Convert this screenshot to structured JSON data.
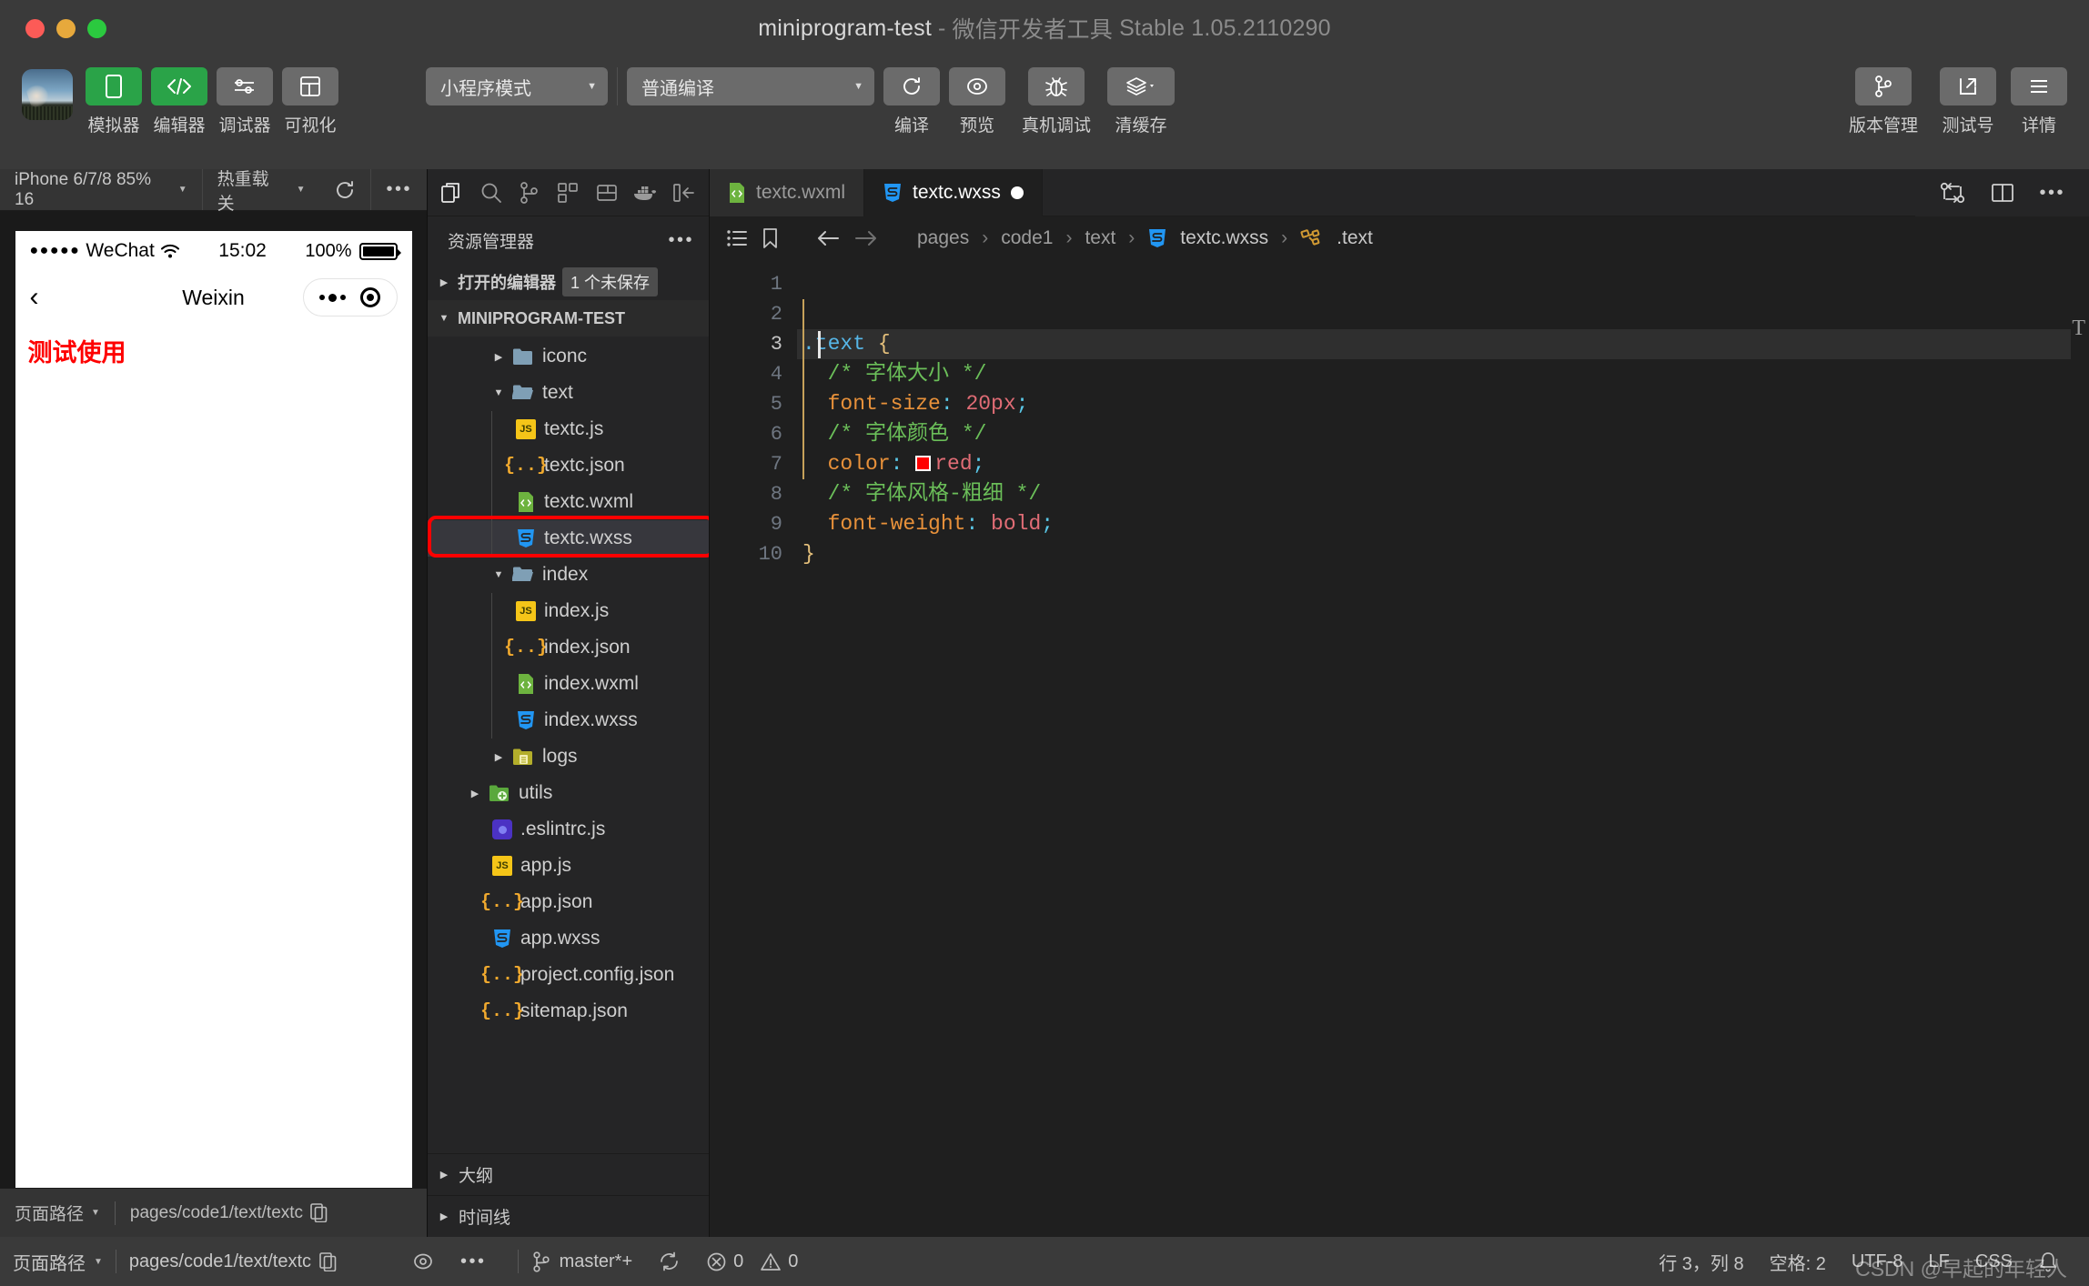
{
  "window": {
    "project": "miniprogram-test",
    "separator": "-",
    "app_name": "微信开发者工具",
    "version": "Stable 1.05.2110290"
  },
  "toolbar": {
    "left_items": [
      {
        "label": "模拟器",
        "icon": "phone-icon",
        "style": "green"
      },
      {
        "label": "编辑器",
        "icon": "code-icon",
        "style": "green"
      },
      {
        "label": "调试器",
        "icon": "sliders-icon",
        "style": "gray"
      },
      {
        "label": "可视化",
        "icon": "layout-icon",
        "style": "gray"
      }
    ],
    "mode_select": "小程序模式",
    "compile_select": "普通编译",
    "center_items": [
      {
        "label": "编译",
        "icon": "refresh-icon"
      },
      {
        "label": "预览",
        "icon": "eye-icon"
      },
      {
        "label": "真机调试",
        "icon": "bug-icon"
      },
      {
        "label": "清缓存",
        "icon": "layers-icon"
      }
    ],
    "right_items": [
      {
        "label": "版本管理",
        "icon": "git-branch-icon"
      },
      {
        "label": "测试号",
        "icon": "external-link-icon"
      },
      {
        "label": "详情",
        "icon": "menu-icon"
      }
    ]
  },
  "simulator": {
    "device": "iPhone 6/7/8 85% 16",
    "hot_reload": "热重载 关",
    "phone": {
      "carrier": "WeChat",
      "signal_dots": "●●●●●",
      "time": "15:02",
      "battery": "100%",
      "nav_title": "Weixin",
      "back_icon": "chevron-left-icon",
      "page_text": "测试使用"
    },
    "bottom": {
      "path_label": "页面路径",
      "path_value": "pages/code1/text/textc"
    }
  },
  "explorer": {
    "activity_icons": [
      "files-icon",
      "search-icon",
      "source-control-icon",
      "extensions-icon",
      "cloud-icon",
      "docker-icon",
      "collapse-icon"
    ],
    "title": "资源管理器",
    "more_icon": "ellipsis-icon",
    "open_editors_label": "打开的编辑器",
    "unsaved_badge": "1 个未保存",
    "project_label": "MINIPROGRAM-TEST",
    "tree": [
      {
        "name": "iconc",
        "kind": "folder",
        "depth": 2,
        "expanded": false,
        "color": "blue"
      },
      {
        "name": "text",
        "kind": "folder",
        "depth": 2,
        "expanded": true,
        "color": "blue"
      },
      {
        "name": "textc.js",
        "kind": "js",
        "depth": 3
      },
      {
        "name": "textc.json",
        "kind": "json",
        "depth": 3
      },
      {
        "name": "textc.wxml",
        "kind": "wxml",
        "depth": 3
      },
      {
        "name": "textc.wxss",
        "kind": "wxss",
        "depth": 3,
        "selected": true,
        "highlighted": true
      },
      {
        "name": "index",
        "kind": "folder",
        "depth": 2,
        "expanded": true,
        "color": "blue"
      },
      {
        "name": "index.js",
        "kind": "js",
        "depth": 3
      },
      {
        "name": "index.json",
        "kind": "json",
        "depth": 3
      },
      {
        "name": "index.wxml",
        "kind": "wxml",
        "depth": 3
      },
      {
        "name": "index.wxss",
        "kind": "wxss",
        "depth": 3
      },
      {
        "name": "logs",
        "kind": "folder",
        "depth": 2,
        "expanded": false,
        "color": "yellow"
      },
      {
        "name": "utils",
        "kind": "folder",
        "depth": 1,
        "expanded": false,
        "color": "green"
      },
      {
        "name": ".eslintrc.js",
        "kind": "eslint",
        "depth": 2
      },
      {
        "name": "app.js",
        "kind": "js",
        "depth": 2
      },
      {
        "name": "app.json",
        "kind": "json",
        "depth": 2
      },
      {
        "name": "app.wxss",
        "kind": "wxss",
        "depth": 2
      },
      {
        "name": "project.config.json",
        "kind": "json",
        "depth": 2
      },
      {
        "name": "sitemap.json",
        "kind": "json",
        "depth": 2
      }
    ],
    "footer_sections": [
      "大纲",
      "时间线"
    ]
  },
  "editor": {
    "tabs": [
      {
        "label": "textc.wxml",
        "icon": "wxml-file-icon",
        "active": false,
        "dirty": false
      },
      {
        "label": "textc.wxss",
        "icon": "wxss-file-icon",
        "active": true,
        "dirty": true
      }
    ],
    "tab_actions": [
      "split-diff-icon",
      "split-editor-icon",
      "ellipsis-icon"
    ],
    "breadcrumb_icons": [
      "outline-icon",
      "bookmark-icon",
      "back-arrow-icon",
      "forward-arrow-icon"
    ],
    "breadcrumb": [
      "pages",
      "code1",
      "text",
      "textc.wxss",
      ".text"
    ],
    "breadcrumb_symbol_icon": "css-symbol-icon",
    "lines": [
      {
        "n": 1,
        "segments": []
      },
      {
        "n": 2,
        "segments": []
      },
      {
        "n": 3,
        "active": true,
        "fold": true,
        "segments": [
          {
            "t": ".text ",
            "c": "sel"
          },
          {
            "t": "{",
            "c": "brace"
          }
        ]
      },
      {
        "n": 4,
        "segments": [
          {
            "t": "  /* 字体大小 */",
            "c": "comment"
          }
        ]
      },
      {
        "n": 5,
        "segments": [
          {
            "t": "  font-size",
            "c": "prop"
          },
          {
            "t": ":",
            "c": "colon"
          },
          {
            "t": " 20px",
            "c": "val"
          },
          {
            "t": ";",
            "c": "colon"
          }
        ]
      },
      {
        "n": 6,
        "segments": [
          {
            "t": "  /* 字体颜色 */",
            "c": "comment"
          }
        ]
      },
      {
        "n": 7,
        "segments": [
          {
            "t": "  color",
            "c": "prop"
          },
          {
            "t": ":",
            "c": "colon"
          },
          {
            "t": " ",
            "c": "plain"
          },
          {
            "t": "SWATCH",
            "c": "swatch"
          },
          {
            "t": "red",
            "c": "val"
          },
          {
            "t": ";",
            "c": "colon"
          }
        ]
      },
      {
        "n": 8,
        "segments": [
          {
            "t": "  /* 字体风格-粗细 */",
            "c": "comment"
          }
        ]
      },
      {
        "n": 9,
        "segments": [
          {
            "t": "  font-weight",
            "c": "prop"
          },
          {
            "t": ":",
            "c": "colon"
          },
          {
            "t": " bold",
            "c": "val"
          },
          {
            "t": ";",
            "c": "colon"
          }
        ]
      },
      {
        "n": 10,
        "segments": [
          {
            "t": "}",
            "c": "brace"
          }
        ]
      }
    ],
    "swatch_color": "#ff0000"
  },
  "statusbar": {
    "page_path_label": "页面路径",
    "page_path_value": "pages/code1/text/textc",
    "copy_icon": "copy-icon",
    "eye_icon": "eye-icon",
    "more_icon": "ellipsis-icon",
    "branch": "master*+",
    "sync_icon": "sync-icon",
    "errors": "0",
    "warnings": "0",
    "cursor_position": "行 3，列 8",
    "indent": "空格: 2",
    "encoding": "UTF-8",
    "eol": "LF",
    "language": "CSS",
    "bell_icon": "bell-icon",
    "watermark": "CSDN @早起的年轻人"
  }
}
